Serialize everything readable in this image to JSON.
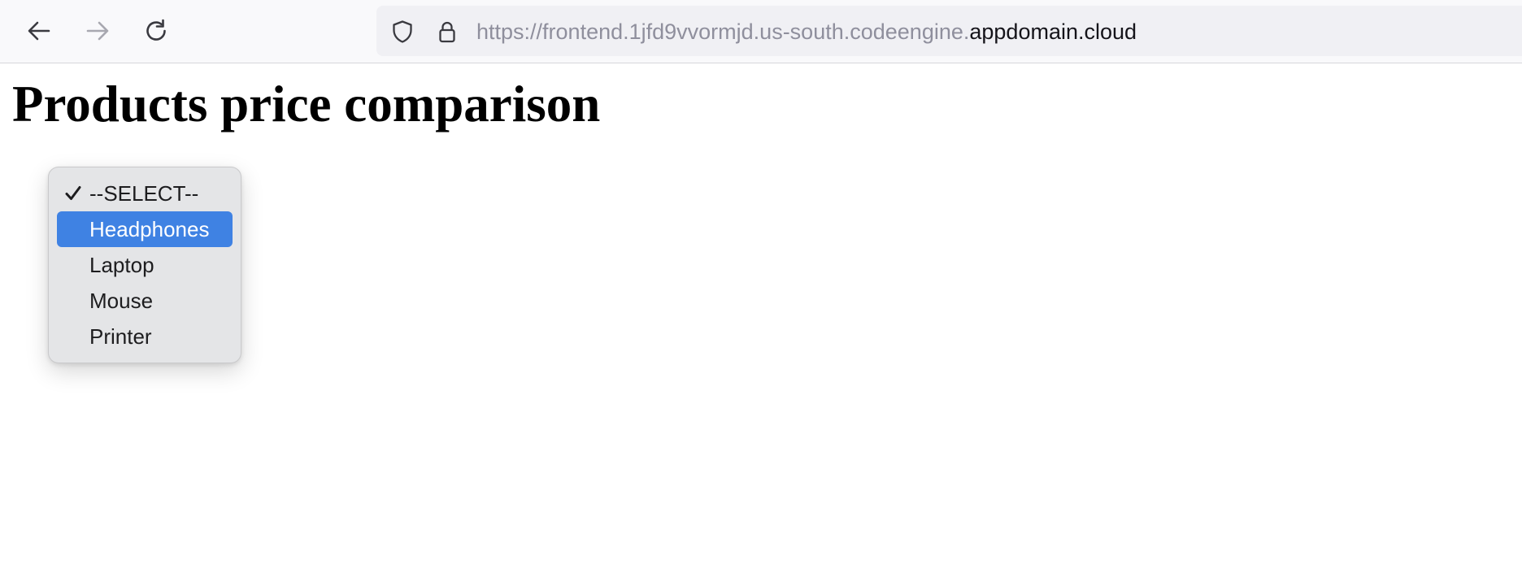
{
  "browser": {
    "url_prefix": "https://frontend.1jfd9vvormjd.us-south.codeengine.",
    "url_domain": "appdomain.cloud",
    "icons": {
      "back": "arrow-left-icon",
      "forward": "arrow-right-icon",
      "reload": "reload-icon",
      "tracking_protection": "shield-icon",
      "secure": "lock-icon"
    }
  },
  "page": {
    "title": "Products price comparison"
  },
  "product_select": {
    "selected_value": "--SELECT--",
    "highlighted_value": "Headphones",
    "options": [
      {
        "label": "--SELECT--",
        "checked": true
      },
      {
        "label": "Headphones",
        "highlighted": true
      },
      {
        "label": "Laptop"
      },
      {
        "label": "Mouse"
      },
      {
        "label": "Printer"
      }
    ],
    "colors": {
      "highlight": "#3f82e3",
      "menu_background": "#e4e5e7"
    }
  }
}
